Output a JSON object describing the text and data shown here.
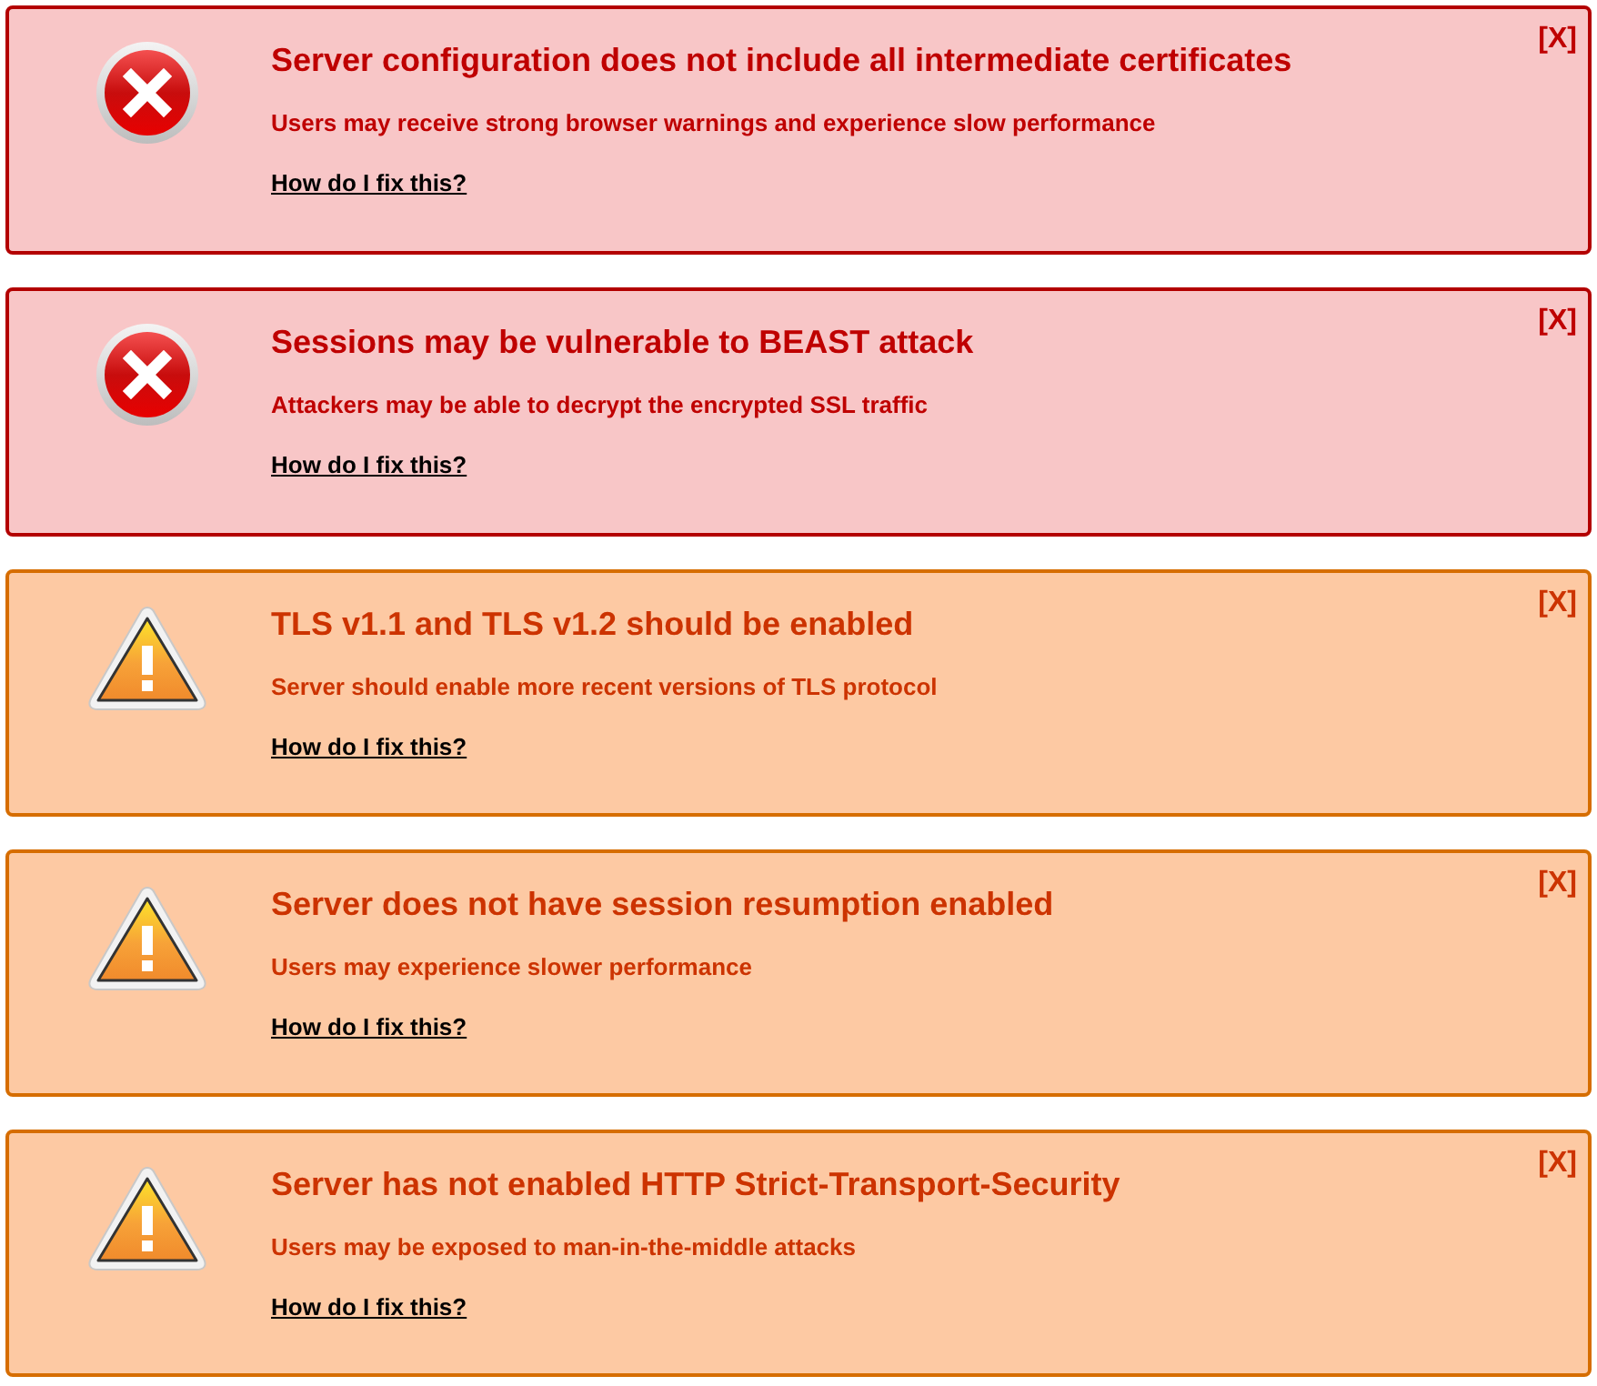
{
  "alerts": [
    {
      "kind": "error",
      "title": "Server configuration does not include all intermediate certificates",
      "description": "Users may receive strong browser warnings and experience slow performance",
      "link": "How do I fix this?",
      "close": "[X]"
    },
    {
      "kind": "error",
      "title": "Sessions may be vulnerable to BEAST attack",
      "description": "Attackers may be able to decrypt the encrypted SSL traffic",
      "link": "How do I fix this?",
      "close": "[X]"
    },
    {
      "kind": "warning",
      "title": "TLS v1.1 and TLS v1.2 should be enabled",
      "description": "Server should enable more recent versions of TLS protocol",
      "link": "How do I fix this?",
      "close": "[X]"
    },
    {
      "kind": "warning",
      "title": "Server does not have session resumption enabled",
      "description": "Users may experience slower performance",
      "link": "How do I fix this?",
      "close": "[X]"
    },
    {
      "kind": "warning",
      "title": "Server has not enabled HTTP Strict-Transport-Security",
      "description": "Users may be exposed to man-in-the-middle attacks",
      "link": "How do I fix this?",
      "close": "[X]"
    }
  ]
}
